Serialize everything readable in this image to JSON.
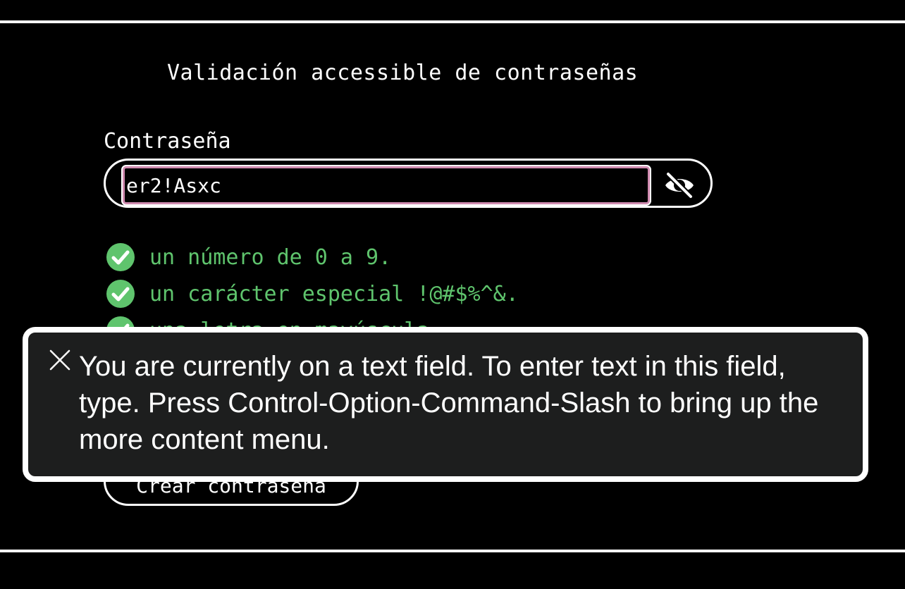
{
  "page": {
    "title": "Validación accessible de contraseñas"
  },
  "password": {
    "label": "Contraseña",
    "value": "er2!Asxc",
    "toggle_icon": "eye-slash-icon"
  },
  "requirements": [
    {
      "text": "un número de 0 a 9.",
      "met": true,
      "icon": "check-circle-icon"
    },
    {
      "text": "un carácter especial !@#$%^&.",
      "met": true,
      "icon": "check-circle-icon"
    },
    {
      "text": "una letra en mayúscula.",
      "met": true,
      "icon": "check-circle-icon"
    }
  ],
  "submit": {
    "label": "Crear contraseña"
  },
  "voiceover": {
    "close_icon": "close-icon",
    "text": "You are currently on a text field. To enter text in this field, type. Press Control-Option-Command-Slash to bring up the more content menu."
  },
  "colors": {
    "background": "#000000",
    "foreground": "#ffffff",
    "success": "#5fc46d",
    "focus_ring": "#d08bb0",
    "overlay_bg": "#1d1e1e"
  }
}
